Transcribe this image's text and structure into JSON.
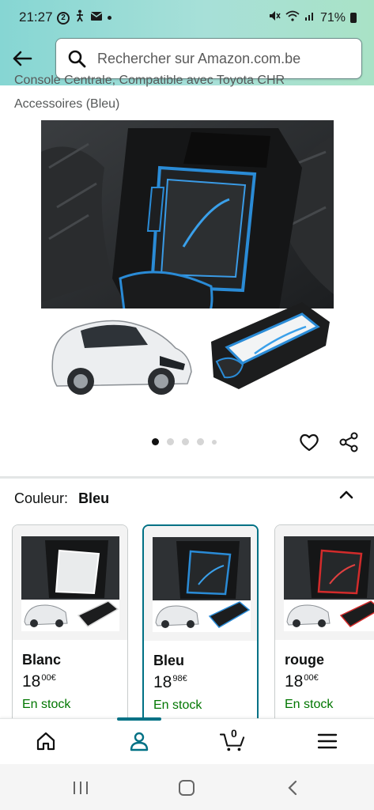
{
  "status_bar": {
    "time": "21:27",
    "notification_count": "2",
    "battery": "71%"
  },
  "header": {
    "search_placeholder": "Rechercher sur Amazon.com.be"
  },
  "product": {
    "title_line1": "Console Centrale, Compatible avec Toyota CHR",
    "title_line2": "Accessoires (Bleu)",
    "image_count": 5,
    "active_image": 1
  },
  "variation": {
    "label": "Couleur:",
    "selected_value": "Bleu",
    "options": [
      {
        "name": "Blanc",
        "price_whole": "18",
        "price_cents": "00",
        "currency": "€",
        "stock": "En stock",
        "accent": "#ffffff"
      },
      {
        "name": "Bleu",
        "price_whole": "18",
        "price_cents": "98",
        "currency": "€",
        "stock": "En stock",
        "accent": "#2a8bd6"
      },
      {
        "name": "rouge",
        "price_whole": "18",
        "price_cents": "00",
        "currency": "€",
        "stock": "En stock",
        "accent": "#d22b2b"
      }
    ]
  },
  "bottom_nav": {
    "items": [
      "home-icon",
      "account-icon",
      "cart-icon",
      "menu-icon"
    ],
    "active": "account-icon",
    "cart_count": "0"
  },
  "colors": {
    "header_gradient_start": "#86d6d3",
    "header_gradient_end": "#a9e2c6",
    "selected_border": "#007185",
    "in_stock": "#007600"
  }
}
